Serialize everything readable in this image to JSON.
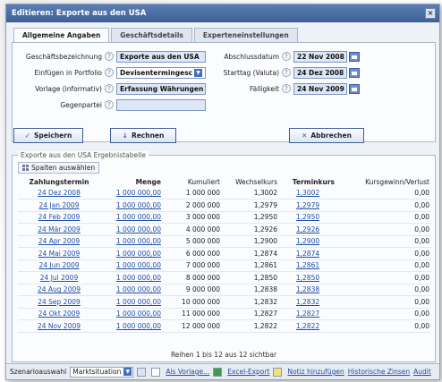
{
  "window": {
    "title": "Editieren: Exporte aus den USA",
    "close_label": "×"
  },
  "tabs": [
    {
      "label": "Allgemeine Angaben",
      "active": true
    },
    {
      "label": "Geschäftsdetails",
      "active": false
    },
    {
      "label": "Experteneinstellungen",
      "active": false
    }
  ],
  "form": {
    "geschaeftsbezeichnung": {
      "label": "Geschäftsbezeichnung",
      "value": "Exporte aus den USA"
    },
    "portfolio": {
      "label": "Einfügen in Portfolio",
      "value": "Devisentermingesc"
    },
    "vorlage": {
      "label": "Vorlage (informativ)",
      "value": "Erfassung Währungen"
    },
    "gegenpartei": {
      "label": "Gegenpartei",
      "value": ""
    },
    "abschlussdatum": {
      "label": "Abschlussdatum",
      "value": "22 Nov 2008"
    },
    "starttag": {
      "label": "Starttag (Valuta)",
      "value": "24 Dez 2008"
    },
    "faelligkeit": {
      "label": "Fälligkeit",
      "value": "24 Nov 2009"
    }
  },
  "buttons": {
    "speichern": "Speichern",
    "rechnen": "Rechnen",
    "abbrechen": "Abbrechen"
  },
  "results": {
    "legend": "Exporte aus den USA Ergebnistabelle",
    "columns_button": "Spalten auswählen",
    "headers": [
      "Zahlungstermin",
      "Menge",
      "Kumuliert",
      "Wechselkurs",
      "Terminkurs",
      "Kursgewinn/Verlust"
    ],
    "rows": [
      [
        "24 Dez 2008",
        "1 000 000,00",
        "1 000 000",
        "1,3002",
        "1,3002",
        "0,00"
      ],
      [
        "24 Jan 2009",
        "1 000 000,00",
        "2 000 000",
        "1,2979",
        "1,2979",
        "0,00"
      ],
      [
        "24 Feb 2009",
        "1 000 000,00",
        "3 000 000",
        "1,2950",
        "1,2950",
        "0,00"
      ],
      [
        "24 Mär 2009",
        "1 000 000,00",
        "4 000 000",
        "1,2926",
        "1,2926",
        "0,00"
      ],
      [
        "24 Apr 2009",
        "1 000 000,00",
        "5 000 000",
        "1,2900",
        "1,2900",
        "0,00"
      ],
      [
        "24 Mai 2009",
        "1 000 000,00",
        "6 000 000",
        "1,2874",
        "1,2874",
        "0,00"
      ],
      [
        "24 Jun 2009",
        "1 000 000,00",
        "7 000 000",
        "1,2861",
        "1,2861",
        "0,00"
      ],
      [
        "24 Jul 2009",
        "1 000 000,00",
        "8 000 000",
        "1,2850",
        "1,2850",
        "0,00"
      ],
      [
        "24 Aug 2009",
        "1 000 000,00",
        "9 000 000",
        "1,2838",
        "1,2838",
        "0,00"
      ],
      [
        "24 Sep 2009",
        "1 000 000,00",
        "10 000 000",
        "1,2832",
        "1,2832",
        "0,00"
      ],
      [
        "24 Okt 2009",
        "1 000 000,00",
        "11 000 000",
        "1,2827",
        "1,2827",
        "0,00"
      ],
      [
        "24 Nov 2009",
        "1 000 000,00",
        "12 000 000",
        "1,2822",
        "1,2822",
        "0,00"
      ]
    ],
    "footer": "Reihen 1 bis 12 aus 12 sichtbar"
  },
  "bottombar": {
    "szenario_label": "Szenarioauswahl",
    "szenario_value": "Marktsituation",
    "als_vorlage": "Als Vorlage...",
    "excel_export": "Excel-Export",
    "notiz": "Notiz hinzufügen",
    "historische_zinsen": "Historische Zinsen",
    "audit": "Audit"
  },
  "colors": {
    "title_bg": "#3d5f95",
    "accent": "#1f4fa8",
    "input_bg": "#dde7f7"
  },
  "icons": [
    "close-icon",
    "help-icon",
    "calendar-icon",
    "checkmark-icon",
    "down-arrow-icon",
    "x-icon",
    "grid-icon",
    "excel-icon",
    "note-icon"
  ]
}
